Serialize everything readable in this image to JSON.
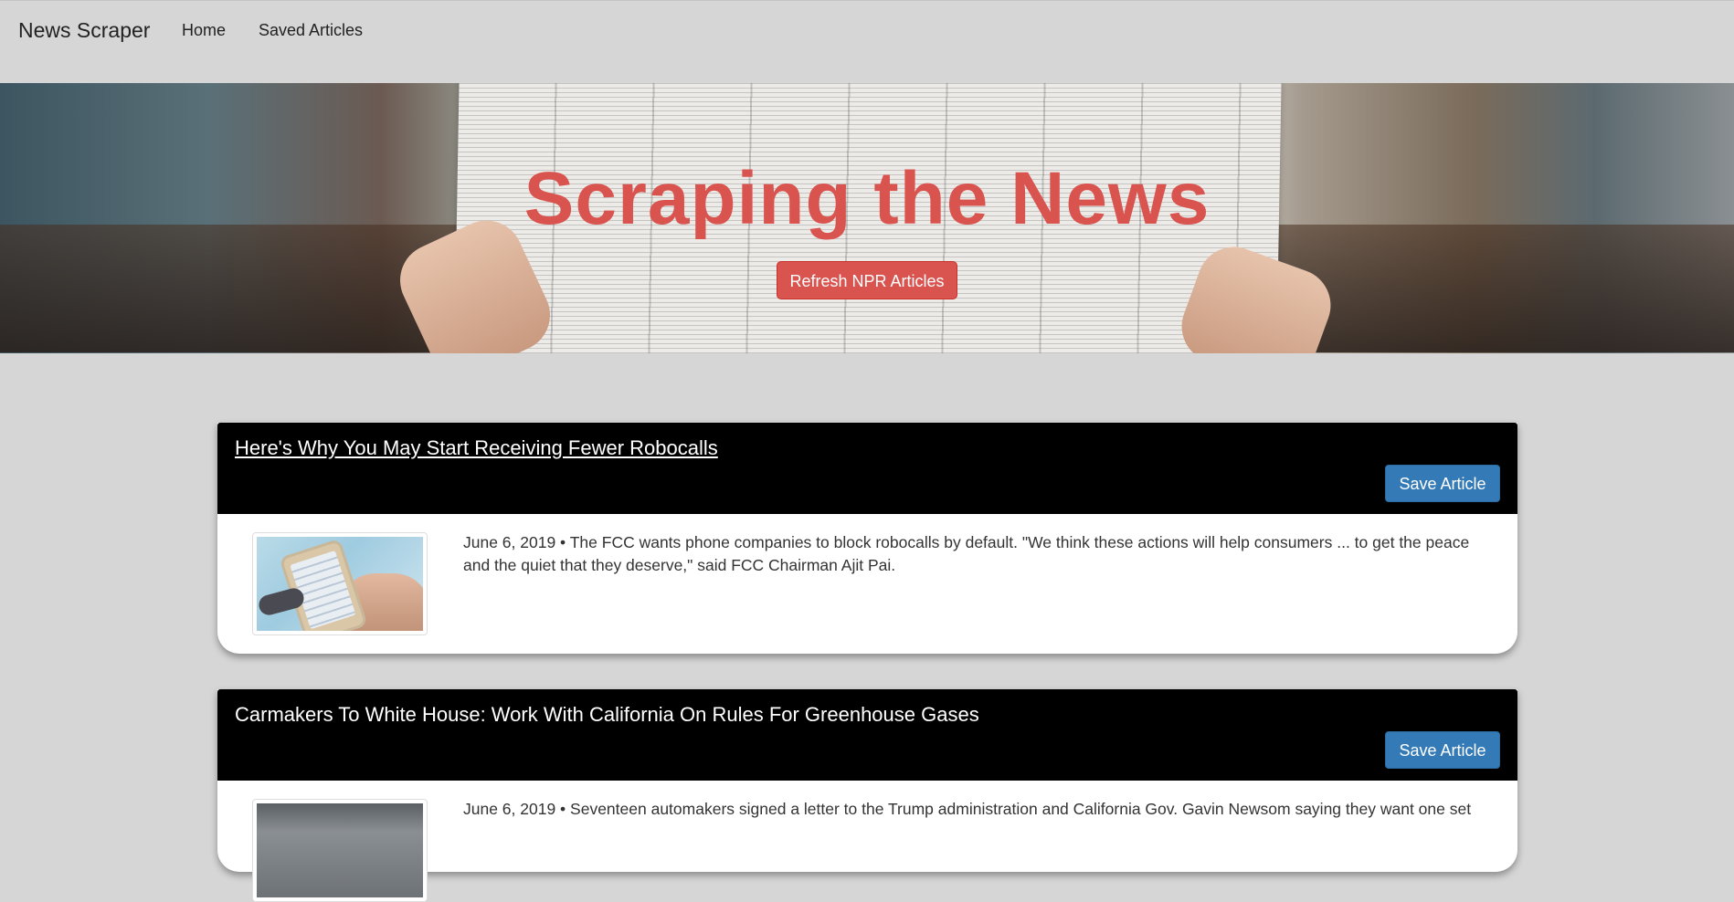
{
  "navbar": {
    "brand": "News Scraper",
    "links": [
      "Home",
      "Saved Articles"
    ]
  },
  "hero": {
    "title": "Scraping the News",
    "refresh_button": "Refresh NPR Articles",
    "accent_color": "#d9534f"
  },
  "articles": [
    {
      "title": "Here's Why You May Start Receiving Fewer Robocalls",
      "save_label": "Save Article",
      "summary": "June 6, 2019 • The FCC wants phone companies to block robocalls by default. \"We think these actions will help consumers ... to get the peace and the quiet that they deserve,\" said FCC Chairman Ajit Pai.",
      "thumbnail": "phone-in-hands-image"
    },
    {
      "title": "Carmakers To White House: Work With California On Rules For Greenhouse Gases",
      "save_label": "Save Article",
      "summary": "June 6, 2019 • Seventeen automakers signed a letter to the Trump administration and California Gov. Gavin Newsom saying they want one set",
      "thumbnail": "traffic-cars-image"
    }
  ],
  "colors": {
    "background": "#d6d6d6",
    "card_header": "#000000",
    "save_button": "#337ab7",
    "refresh_button": "#d9534f"
  }
}
